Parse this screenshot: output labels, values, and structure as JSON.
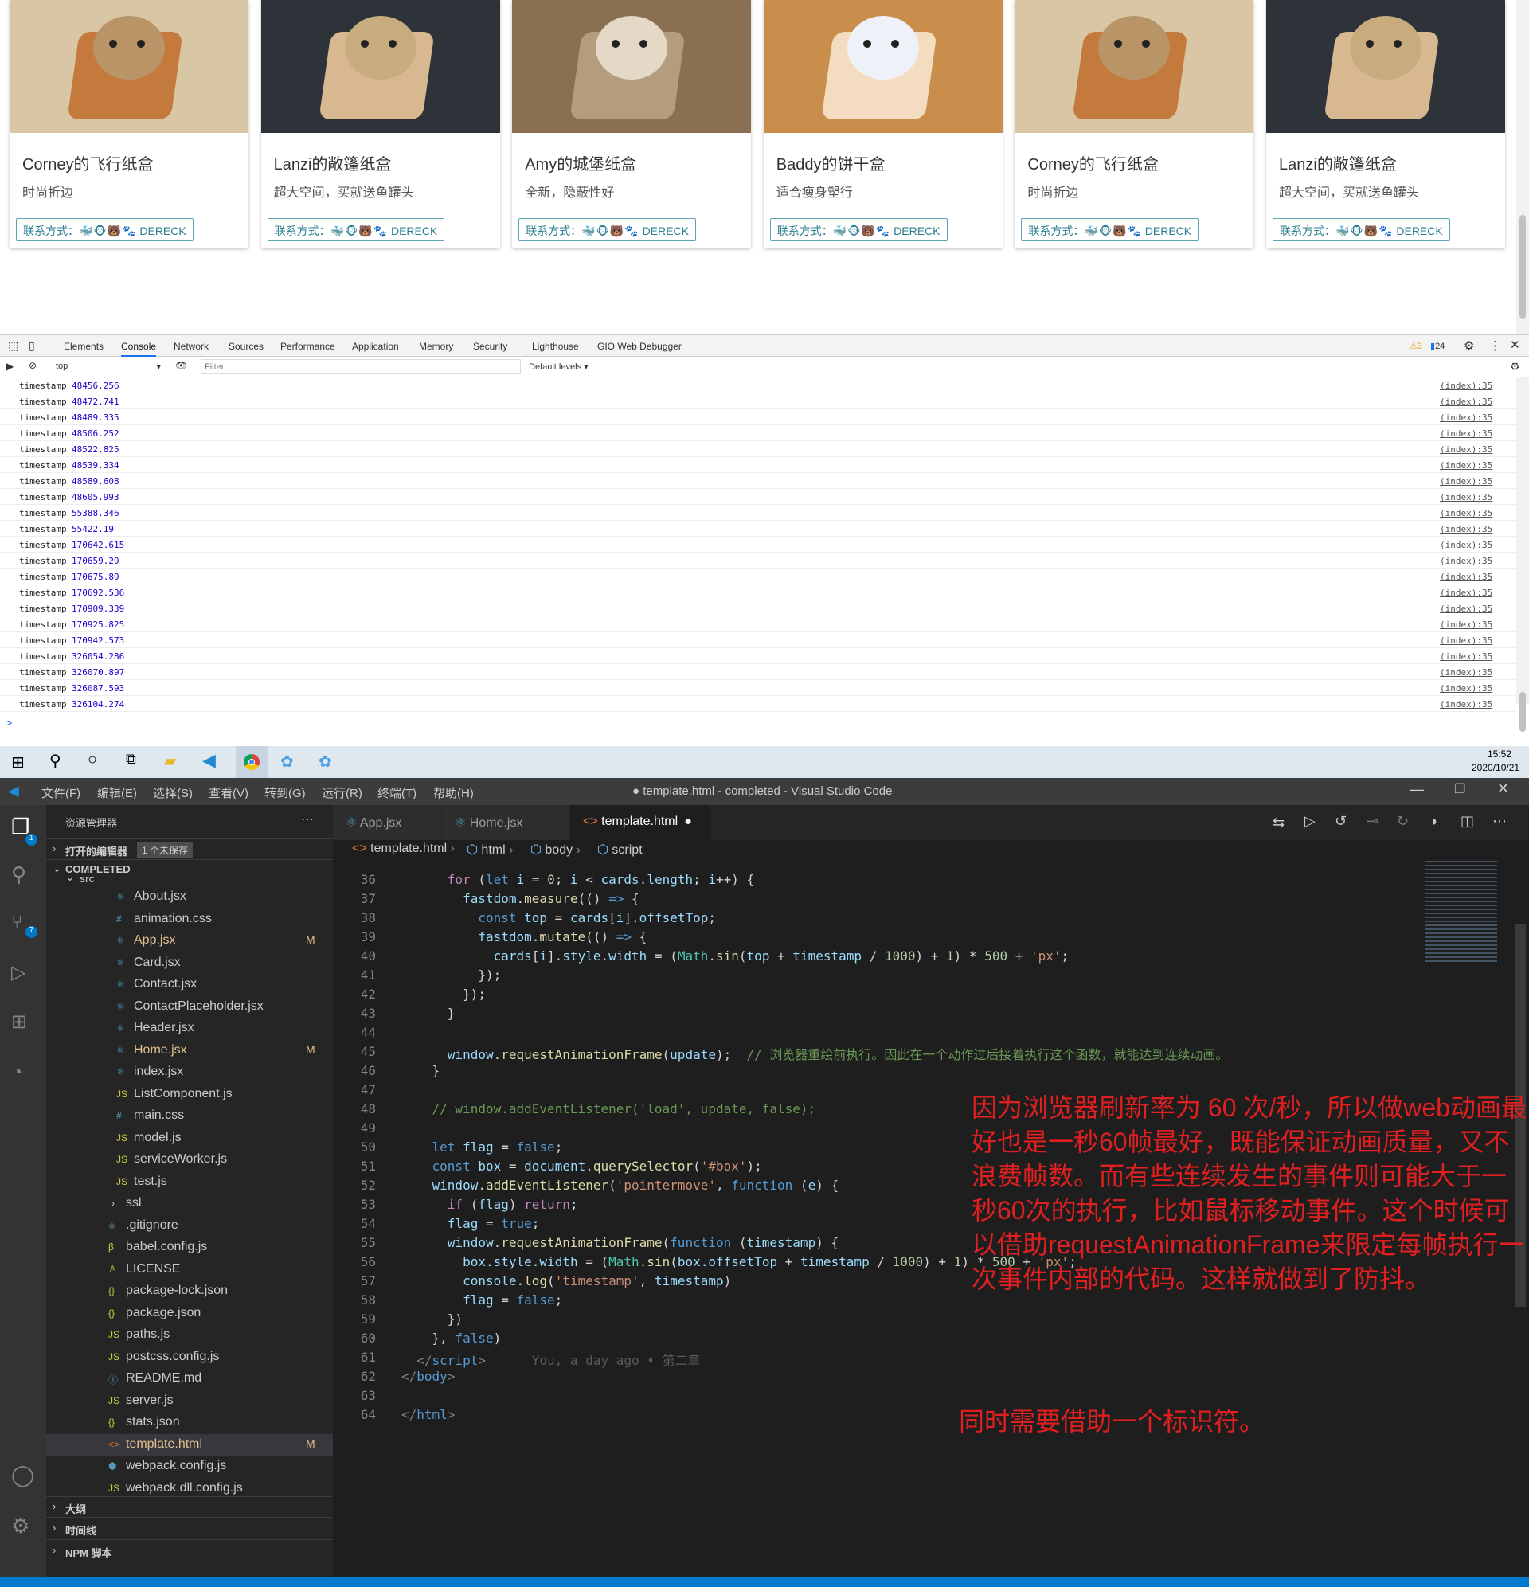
{
  "cards": [
    {
      "title": "Corney的飞行纸盒",
      "desc": "时尚折边",
      "contact_label": "联系方式：",
      "emoji": "🐳🐵🐻🐾",
      "name": "DERECK"
    },
    {
      "title": "Lanzi的敞篷纸盒",
      "desc": "超大空间，买就送鱼罐头",
      "contact_label": "联系方式：",
      "emoji": "🐳🐵🐻🐾",
      "name": "DERECK"
    },
    {
      "title": "Amy的城堡纸盒",
      "desc": "全新，隐蔽性好",
      "contact_label": "联系方式：",
      "emoji": "🐳🐵🐻🐾",
      "name": "DERECK"
    },
    {
      "title": "Baddy的饼干盒",
      "desc": "适合瘦身塑行",
      "contact_label": "联系方式：",
      "emoji": "🐳🐵🐻🐾",
      "name": "DERECK"
    },
    {
      "title": "Corney的飞行纸盒",
      "desc": "时尚折边",
      "contact_label": "联系方式：",
      "emoji": "🐳🐵🐻🐾",
      "name": "DERECK"
    },
    {
      "title": "Lanzi的敞篷纸盒",
      "desc": "超大空间，买就送鱼罐头",
      "contact_label": "联系方式：",
      "emoji": "🐳🐵🐻🐾",
      "name": "DERECK"
    }
  ],
  "devtools": {
    "tabs": [
      "Elements",
      "Console",
      "Network",
      "Sources",
      "Performance",
      "Application",
      "Memory",
      "Security",
      "Lighthouse",
      "GIO Web Debugger"
    ],
    "active_tab": "Console",
    "warnings": "3",
    "messages": "24",
    "context": "top",
    "filter_placeholder": "Filter",
    "levels": "Default levels",
    "log_key": "timestamp",
    "log_source": "(index):35",
    "logs": [
      "48456.256",
      "48472.741",
      "48489.335",
      "48506.252",
      "48522.825",
      "48539.334",
      "48589.608",
      "48605.993",
      "55388.346",
      "55422.19",
      "170642.615",
      "170659.29",
      "170675.89",
      "170692.536",
      "170909.339",
      "170925.825",
      "170942.573",
      "326054.286",
      "326070.897",
      "326087.593",
      "326104.274"
    ],
    "prompt": ">"
  },
  "taskbar": {
    "time": "15:52",
    "date": "2020/10/21"
  },
  "vscode": {
    "title": "● template.html - completed - Visual Studio Code",
    "menu": [
      "文件(F)",
      "编辑(E)",
      "选择(S)",
      "查看(V)",
      "转到(G)",
      "运行(R)",
      "终端(T)",
      "帮助(H)"
    ],
    "explorer_title": "资源管理器",
    "open_editors": "打开的编辑器",
    "unsaved": "1 个未保存",
    "project": "COMPLETED",
    "src_folder": "src",
    "files": [
      {
        "name": "About.jsx",
        "icon": "⚛",
        "color": "#519aba",
        "indent": 1,
        "mod": ""
      },
      {
        "name": "animation.css",
        "icon": "#",
        "color": "#519aba",
        "indent": 1,
        "mod": ""
      },
      {
        "name": "App.jsx",
        "icon": "⚛",
        "color": "#519aba",
        "indent": 1,
        "mod": "M"
      },
      {
        "name": "Card.jsx",
        "icon": "⚛",
        "color": "#519aba",
        "indent": 1,
        "mod": ""
      },
      {
        "name": "Contact.jsx",
        "icon": "⚛",
        "color": "#519aba",
        "indent": 1,
        "mod": ""
      },
      {
        "name": "ContactPlaceholder.jsx",
        "icon": "⚛",
        "color": "#519aba",
        "indent": 1,
        "mod": ""
      },
      {
        "name": "Header.jsx",
        "icon": "⚛",
        "color": "#519aba",
        "indent": 1,
        "mod": ""
      },
      {
        "name": "Home.jsx",
        "icon": "⚛",
        "color": "#519aba",
        "indent": 1,
        "mod": "M"
      },
      {
        "name": "index.jsx",
        "icon": "⚛",
        "color": "#519aba",
        "indent": 1,
        "mod": ""
      },
      {
        "name": "ListComponent.js",
        "icon": "JS",
        "color": "#cbcb41",
        "indent": 1,
        "mod": ""
      },
      {
        "name": "main.css",
        "icon": "#",
        "color": "#519aba",
        "indent": 1,
        "mod": ""
      },
      {
        "name": "model.js",
        "icon": "JS",
        "color": "#cbcb41",
        "indent": 1,
        "mod": ""
      },
      {
        "name": "serviceWorker.js",
        "icon": "JS",
        "color": "#cbcb41",
        "indent": 1,
        "mod": ""
      },
      {
        "name": "test.js",
        "icon": "JS",
        "color": "#cbcb41",
        "indent": 1,
        "mod": ""
      },
      {
        "name": "ssl",
        "icon": "›",
        "color": "#ccc",
        "indent": 0,
        "mod": ""
      },
      {
        "name": ".gitignore",
        "icon": "◆",
        "color": "#41535b",
        "indent": 0,
        "mod": ""
      },
      {
        "name": "babel.config.js",
        "icon": "β",
        "color": "#cbcb41",
        "indent": 0,
        "mod": ""
      },
      {
        "name": "LICENSE",
        "icon": "♙",
        "color": "#cbcb41",
        "indent": 0,
        "mod": ""
      },
      {
        "name": "package-lock.json",
        "icon": "{}",
        "color": "#cbcb41",
        "indent": 0,
        "mod": ""
      },
      {
        "name": "package.json",
        "icon": "{}",
        "color": "#cbcb41",
        "indent": 0,
        "mod": ""
      },
      {
        "name": "paths.js",
        "icon": "JS",
        "color": "#cbcb41",
        "indent": 0,
        "mod": ""
      },
      {
        "name": "postcss.config.js",
        "icon": "JS",
        "color": "#cbcb41",
        "indent": 0,
        "mod": ""
      },
      {
        "name": "README.md",
        "icon": "ⓘ",
        "color": "#519aba",
        "indent": 0,
        "mod": ""
      },
      {
        "name": "server.js",
        "icon": "JS",
        "color": "#cbcb41",
        "indent": 0,
        "mod": ""
      },
      {
        "name": "stats.json",
        "icon": "{}",
        "color": "#cbcb41",
        "indent": 0,
        "mod": ""
      },
      {
        "name": "template.html",
        "icon": "<>",
        "color": "#e37933",
        "indent": 0,
        "mod": "M"
      },
      {
        "name": "webpack.config.js",
        "icon": "⬢",
        "color": "#519aba",
        "indent": 0,
        "mod": ""
      },
      {
        "name": "webpack.dll.config.js",
        "icon": "JS",
        "color": "#cbcb41",
        "indent": 0,
        "mod": ""
      }
    ],
    "outline": "大纲",
    "timeline": "时间线",
    "npm": "NPM 脚本",
    "tabs": [
      "App.jsx",
      "Home.jsx",
      "template.html"
    ],
    "breadcrumb": [
      "template.html",
      "html",
      "body",
      "script"
    ],
    "blame": "You, a day ago • 第二章"
  },
  "annotation": "因为浏览器刷新率为 60 次/秒，所以做web动画最好也是一秒60帧最好，既能保证动画质量，又不浪费帧数。而有些连续发生的事件则可能大于一秒60次的执行，比如鼠标移动事件。这个时候可以借助requestAnimationFrame来限定每帧执行一次事件内部的代码。这样就做到了防抖。",
  "annotation2": "同时需要借助一个标识符。"
}
